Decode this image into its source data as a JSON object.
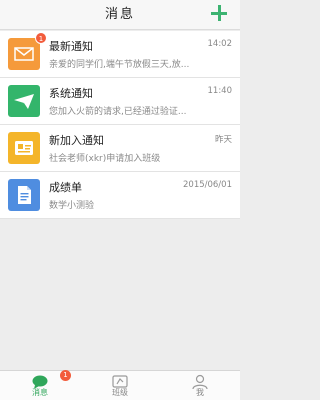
{
  "header": {
    "title": "消息",
    "add_icon": "plus-icon"
  },
  "messages": [
    {
      "name": "最新通知",
      "time": "14:02",
      "preview": "亲爱的同学们,端午节放假三天,放...",
      "badge": "1",
      "icon": "envelope-icon",
      "color": "#f59a3b"
    },
    {
      "name": "系统通知",
      "time": "11:40",
      "preview": "您加入火箭的请求,已经通过验证...",
      "icon": "paper-plane-icon",
      "color": "#33b56b"
    },
    {
      "name": "新加入通知",
      "time": "昨天",
      "preview": "社会老师(xkr)申请加入班级",
      "icon": "id-card-icon",
      "color": "#f4b52a"
    },
    {
      "name": "成绩单",
      "time": "2015/06/01",
      "preview": "数学小测验",
      "icon": "document-icon",
      "color": "#4f8de0"
    }
  ],
  "tabs": [
    {
      "label": "消息",
      "badge": "1",
      "icon": "chat-bubble-icon",
      "active": true
    },
    {
      "label": "班级",
      "icon": "class-board-icon"
    },
    {
      "label": "我",
      "icon": "person-icon"
    }
  ]
}
